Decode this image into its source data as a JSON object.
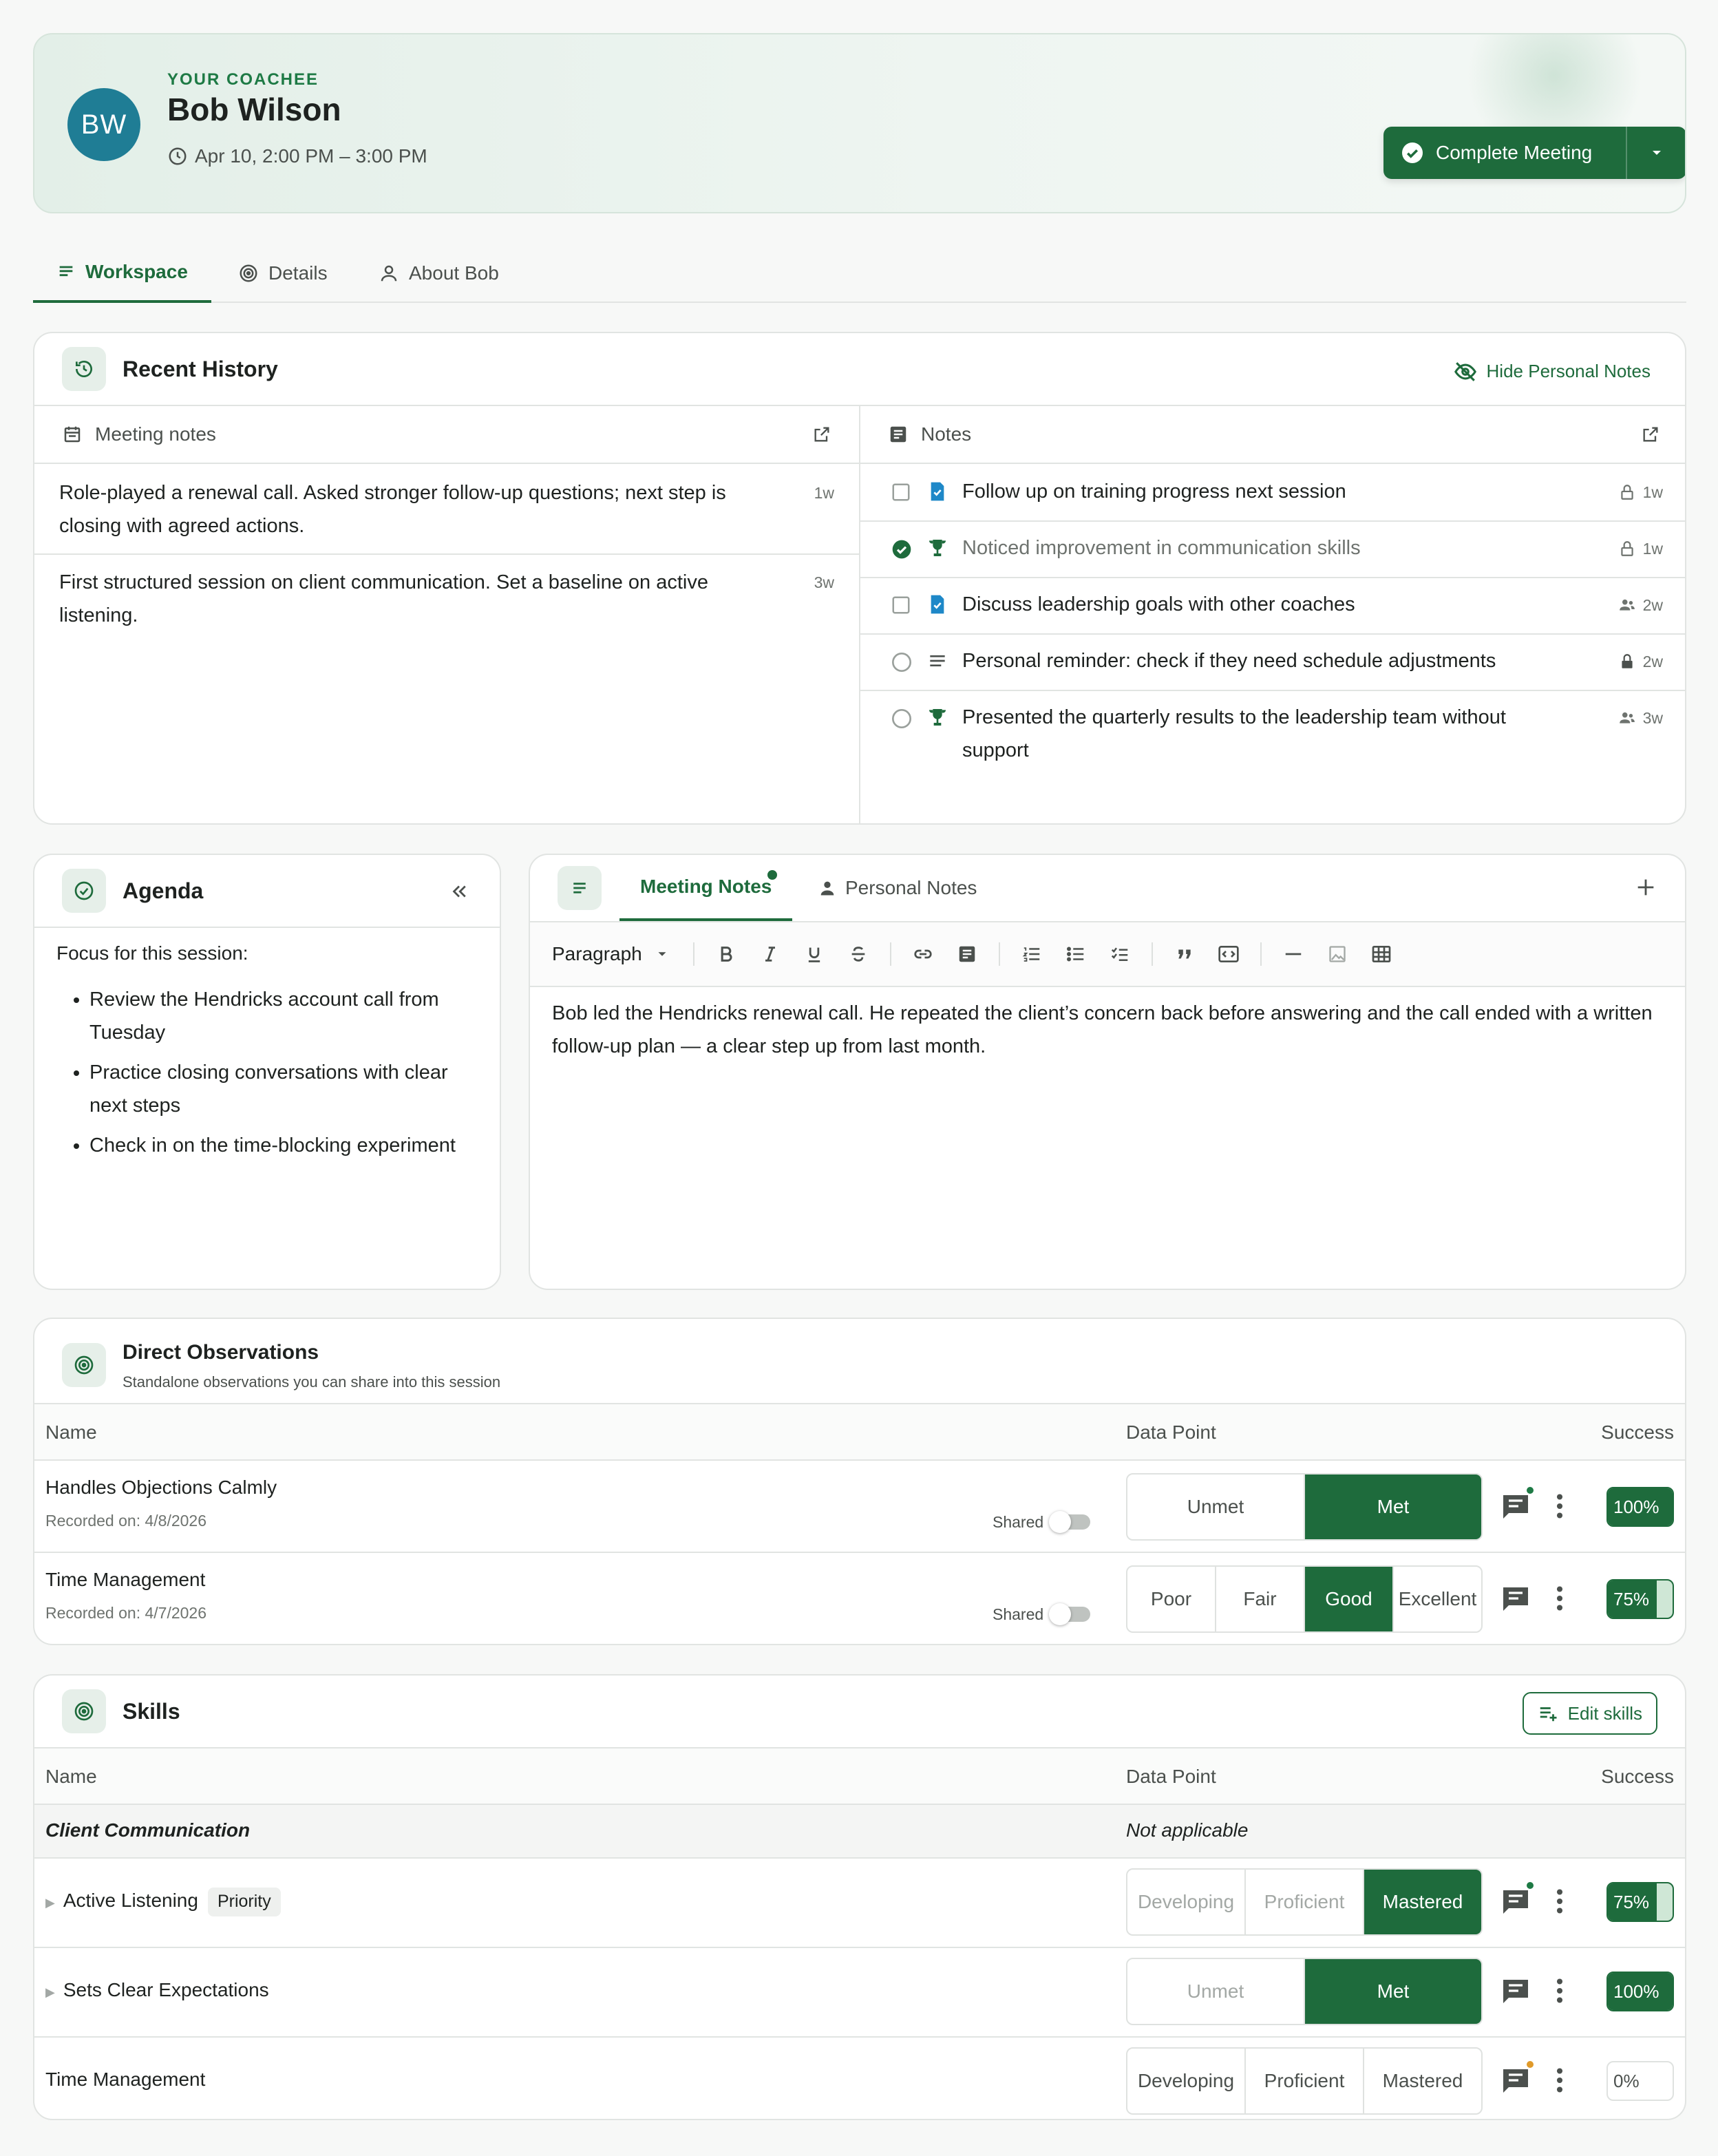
{
  "header": {
    "avatar_initials": "BW",
    "eyebrow": "YOUR COACHEE",
    "name": "Bob Wilson",
    "time": "Apr 10, 2:00 PM – 3:00 PM",
    "complete_label": "Complete Meeting",
    "accent": "#1e6b3c",
    "avatar_color": "#1f7d95"
  },
  "tabs": [
    {
      "label": "Workspace",
      "icon": "list-icon",
      "active": true
    },
    {
      "label": "Details",
      "icon": "target-icon",
      "active": false
    },
    {
      "label": "About Bob",
      "icon": "person-icon",
      "active": false
    }
  ],
  "history": {
    "title": "Recent History",
    "hide_label": "Hide Personal Notes",
    "meeting_notes_header": "Meeting notes",
    "notes_header": "Notes",
    "meeting_notes": [
      {
        "text": "Role-played a renewal call. Asked stronger follow-up questions; next step is closing with agreed actions.",
        "age": "1w"
      },
      {
        "text": "First structured session on client communication. Set a baseline on active listening.",
        "age": "3w"
      }
    ],
    "notes": [
      {
        "text": "Follow up on training progress next session",
        "check": "checkbox",
        "type": "task-icon",
        "privacy": "lock-outline-icon",
        "age": "1w"
      },
      {
        "text": "Noticed improvement in communication skills",
        "check": "checked",
        "type": "trophy-icon",
        "privacy": "lock-outline-icon",
        "age": "1w"
      },
      {
        "text": "Discuss leadership goals with other coaches",
        "check": "checkbox",
        "type": "task-icon",
        "privacy": "people-icon",
        "age": "2w"
      },
      {
        "text": "Personal reminder: check if they need schedule adjustments",
        "check": "radio",
        "type": "text-lines-icon",
        "privacy": "lock-filled-icon",
        "age": "2w"
      },
      {
        "text": "Presented the quarterly results to the leadership team without support",
        "check": "radio",
        "type": "trophy-icon",
        "privacy": "people-icon",
        "age": "3w"
      }
    ]
  },
  "agenda": {
    "title": "Agenda",
    "intro": "Focus for this session:",
    "items": [
      "Review the Hendricks account call from Tuesday",
      "Practice closing conversations with clear next steps",
      "Check in on the time-blocking experiment"
    ]
  },
  "editor": {
    "tab_meeting_notes": "Meeting Notes",
    "tab_personal_notes": "Personal Notes",
    "paragraph_label": "Paragraph",
    "body": "Bob led the Hendricks renewal call. He repeated the client’s concern back before answering and the call ended with a written follow-up plan — a clear step up from last month."
  },
  "observations": {
    "title": "Direct Observations",
    "subtitle": "Standalone observations you can share into this session",
    "col_name": "Name",
    "col_data": "Data Point",
    "col_success": "Success",
    "shared_label": "Shared",
    "rows": [
      {
        "name": "Handles Objections Calmly",
        "recorded": "Recorded on: 4/8/2026",
        "options": [
          "Unmet",
          "Met"
        ],
        "selected": 1,
        "success": "100%",
        "fraction": 1.0,
        "comment_badge": true
      },
      {
        "name": "Time Management",
        "recorded": "Recorded on: 4/7/2026",
        "options": [
          "Poor",
          "Fair",
          "Good",
          "Excellent"
        ],
        "selected": 2,
        "success": "75%",
        "fraction": 0.75,
        "comment_badge": false
      }
    ]
  },
  "skills": {
    "title": "Skills",
    "edit_label": "Edit skills",
    "col_name": "Name",
    "col_data": "Data Point",
    "col_success": "Success",
    "group_name": "Client Communication",
    "group_value": "Not applicable",
    "priority_label": "Priority",
    "rows": [
      {
        "name": "Active Listening",
        "options": [
          "Developing",
          "Proficient",
          "Mastered"
        ],
        "selected": 2,
        "success": "75%",
        "fraction": 0.75,
        "badge": "green"
      },
      {
        "name": "Sets Clear Expectations",
        "options": [
          "Unmet",
          "Met"
        ],
        "selected": 1,
        "success": "100%",
        "fraction": 1.0,
        "badge": "none"
      },
      {
        "name": "Time Management",
        "options": [
          "Developing",
          "Proficient",
          "Mastered"
        ],
        "selected": -1,
        "success": "0%",
        "fraction": 0,
        "badge": "orange"
      }
    ]
  }
}
